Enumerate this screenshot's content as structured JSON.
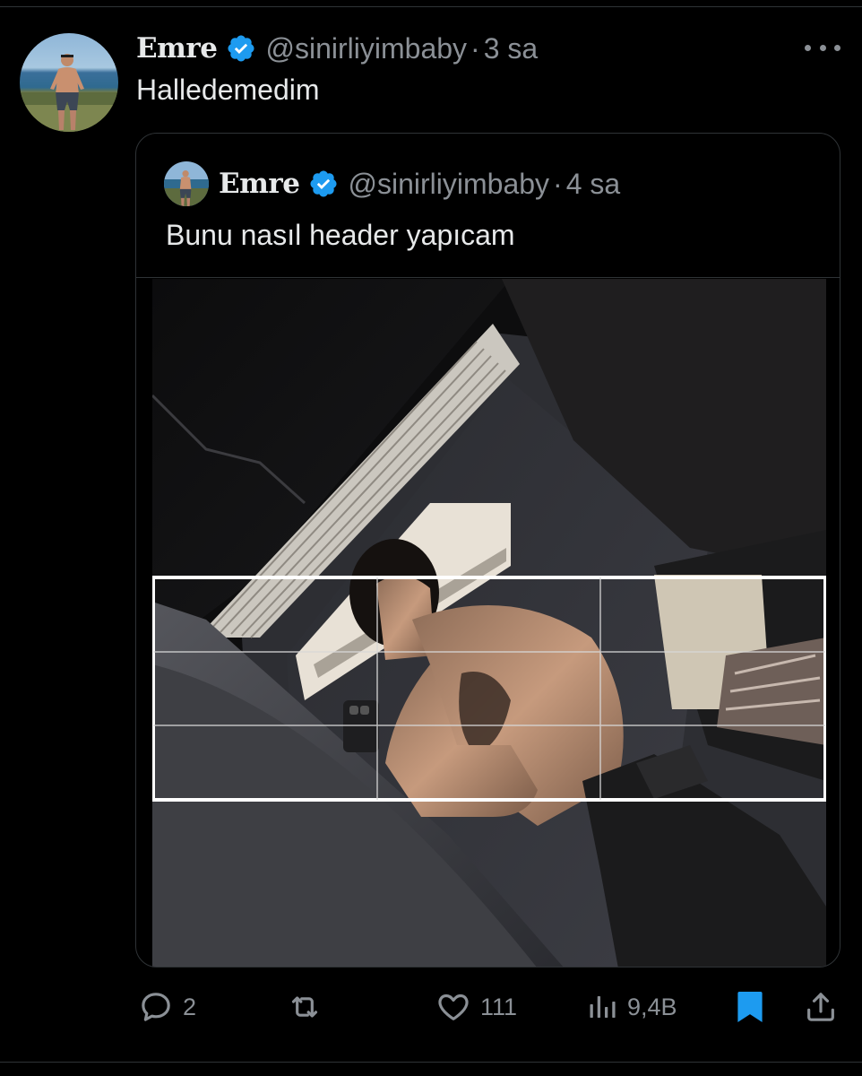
{
  "tweet": {
    "author": {
      "name": "Emre",
      "handle": "@sinirliyimbaby",
      "verified": true
    },
    "separator": "·",
    "time": "3 sa",
    "text": "Halledemedim"
  },
  "quoted_tweet": {
    "author": {
      "name": "Emre",
      "handle": "@sinirliyimbaby",
      "verified": true
    },
    "separator": "·",
    "time": "4 sa",
    "text": "Bunu nasıl header yapıcam"
  },
  "actions": {
    "replies": "2",
    "retweets": "",
    "likes": "111",
    "views": "9,4B",
    "bookmarked": true
  },
  "colors": {
    "background": "#000000",
    "text_primary": "#e7e9ea",
    "text_secondary": "#8b9096",
    "verified_blue": "#1d9bf0",
    "border": "#2f3336",
    "bookmark_active": "#1d9bf0"
  },
  "icons": {
    "more": "more-icon",
    "verified": "verified-badge-icon",
    "reply": "reply-icon",
    "retweet": "retweet-icon",
    "like": "heart-icon",
    "views": "views-chart-icon",
    "bookmark": "bookmark-icon",
    "share": "share-icon"
  }
}
